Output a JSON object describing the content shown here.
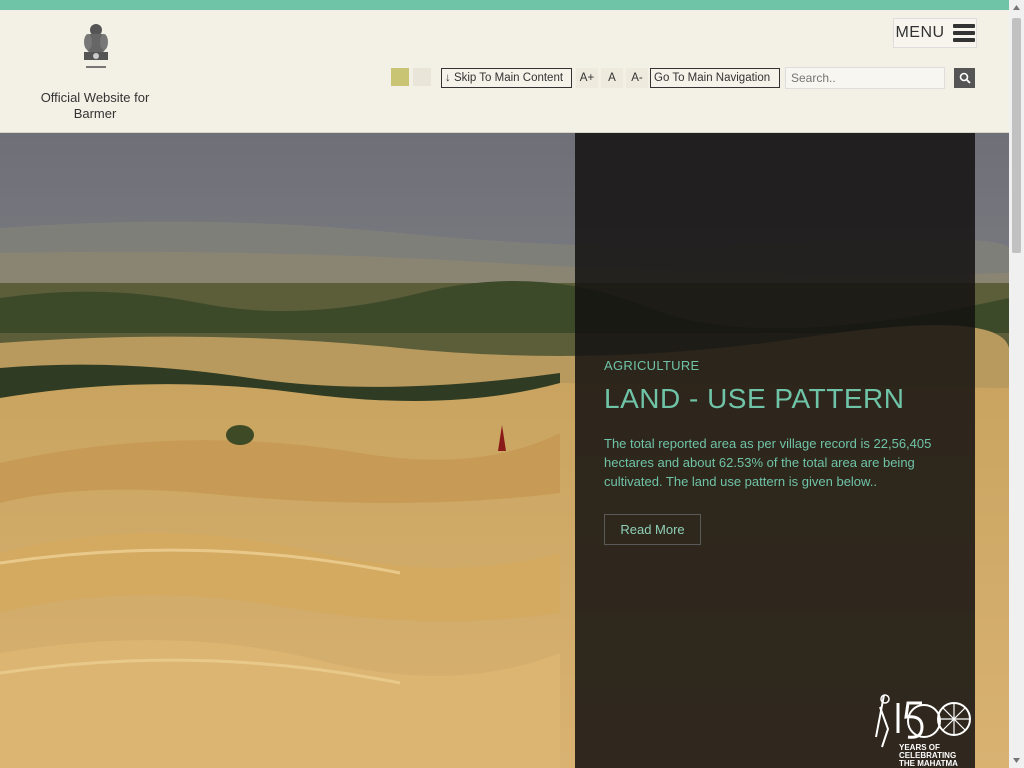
{
  "site": {
    "title": "Official Website for Barmer"
  },
  "menu": {
    "label": "MENU"
  },
  "accessibility": {
    "skip_main": "↓ Skip To Main Content",
    "font_increase": "A+",
    "font_normal": "A",
    "font_decrease": "A-",
    "goto_nav": "Go To Main Navigation"
  },
  "search": {
    "placeholder": "Search.."
  },
  "slide": {
    "category": "AGRICULTURE",
    "title": "LAND - USE PATTERN",
    "description": "The total reported area as per village record is 22,56,405 hectares and about 62.53% of the total area are being cultivated. The land use pattern is given below..",
    "read_more": "Read More"
  },
  "badge": {
    "line1": "YEARS OF",
    "line2": "CELEBRATING",
    "line3": "THE MAHATMA"
  },
  "colors": {
    "accent": "#6fc3a7",
    "header_bg": "#f3f0e6",
    "panel_bg": "#141210"
  },
  "icons": [
    "hamburger-icon",
    "search-icon",
    "national-emblem",
    "anniversary-logo"
  ]
}
